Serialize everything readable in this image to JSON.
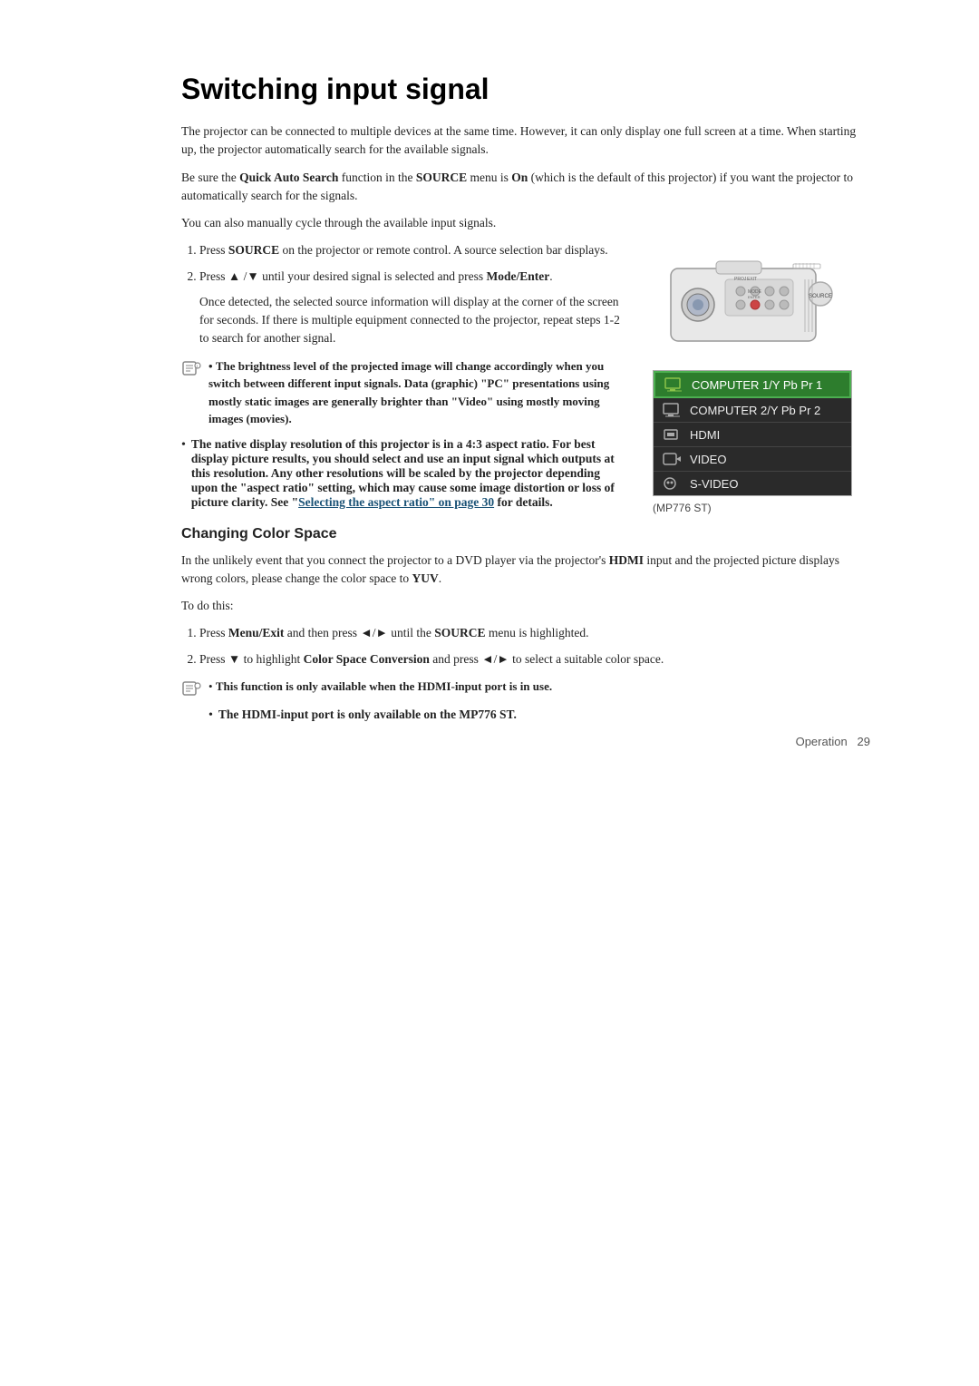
{
  "page": {
    "title": "Switching input signal",
    "intro1": "The projector can be connected to multiple devices at the same time. However, it can only display one full screen at a time. When starting up, the projector automatically search for the available signals.",
    "intro2_prefix": "Be sure the ",
    "intro2_bold1": "Quick Auto Search",
    "intro2_mid": " function in the ",
    "intro2_source": "SOURCE",
    "intro2_mid2": " menu is ",
    "intro2_on": "On",
    "intro2_suffix": " (which is the default of this projector) if you want the projector to automatically search for the signals.",
    "intro3": "You can also manually cycle through the available input signals.",
    "steps": [
      {
        "num": "1.",
        "text_prefix": "Press ",
        "text_bold": "SOURCE",
        "text_suffix": " on the projector or remote control. A source selection bar displays."
      },
      {
        "num": "2.",
        "text_prefix": "Press ▲ /▼ until your desired signal is selected and press ",
        "text_bold": "Mode/Enter",
        "text_suffix": "."
      }
    ],
    "step2_extra": "Once detected, the selected source information will display at the corner of the screen for seconds. If there is multiple equipment connected to the projector, repeat steps 1-2 to search for another signal.",
    "note1_bold": "The brightness level of the projected image will change accordingly when you switch between different input signals. Data (graphic) \"PC\" presentations using mostly static images are generally brighter than \"Video\" using mostly moving images (movies).",
    "note2_bold": "The native display resolution of this projector is in a 4:3 aspect ratio. For best display picture results, you should select and use an input signal which outputs at this resolution. Any other resolutions will be scaled by the projector depending upon the \"aspect ratio\" setting, which may cause some image distortion or loss of picture clarity. See \"",
    "note2_link": "Selecting the aspect ratio\" on page 30",
    "note2_suffix": " for details.",
    "source_menu": {
      "items": [
        {
          "label": "COMPUTER 1/Y Pb Pr 1",
          "active": true
        },
        {
          "label": "COMPUTER 2/Y Pb Pr 2",
          "active": false
        },
        {
          "label": "HDMI",
          "active": false
        },
        {
          "label": "VIDEO",
          "active": false
        },
        {
          "label": "S-VIDEO",
          "active": false
        }
      ],
      "caption": "(MP776 ST)"
    },
    "section_changing": {
      "title": "Changing Color Space",
      "para1_prefix": "In the unlikely event that you connect the projector to a DVD player via the projector's ",
      "para1_bold": "HDMI",
      "para1_suffix": " input and the projected picture displays wrong colors, please change the color space to ",
      "para1_bold2": "YUV",
      "para1_end": ".",
      "para2": "To do this:",
      "steps": [
        {
          "num": "1.",
          "text_prefix": "Press ",
          "text_bold": "Menu/Exit",
          "text_mid": " and then press ◄/► until the ",
          "text_bold2": "SOURCE",
          "text_suffix": " menu is highlighted."
        },
        {
          "num": "2.",
          "text_prefix": "Press ▼ to highlight ",
          "text_bold": "Color Space Conversion",
          "text_mid": " and press ◄/► to select a suitable color space."
        }
      ],
      "note3_bold": "This function is only available when the HDMI-input port is in use.",
      "note4_bold": "The HDMI-input port is only available on the MP776 ST."
    },
    "footer": {
      "text": "Operation",
      "page_num": "29"
    }
  }
}
